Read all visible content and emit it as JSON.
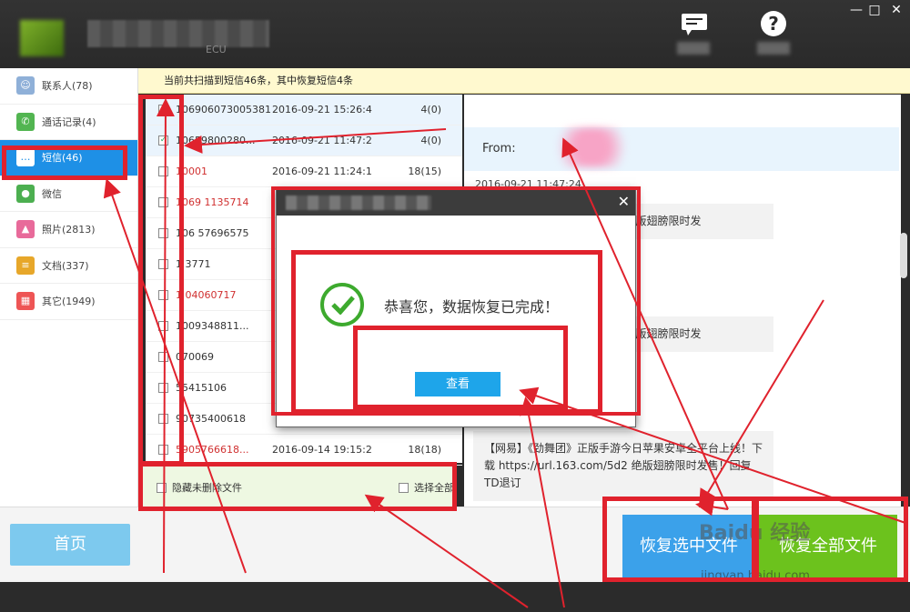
{
  "window": {
    "subtitle": "ECU",
    "close_label": "✕",
    "minimize_label": "—",
    "maximize_label": "□",
    "help_label": "?"
  },
  "notice": "当前共扫描到短信46条，其中恢复短信4条",
  "sidebar": {
    "items": [
      {
        "label": "联系人(78)",
        "icon": "contacts-icon",
        "color": "#8fb0d8"
      },
      {
        "label": "通话记录(4)",
        "icon": "phone-icon",
        "color": "#52b551"
      },
      {
        "label": "短信(46)",
        "icon": "sms-icon",
        "color": "#ffffff"
      },
      {
        "label": "微信",
        "icon": "wechat-icon",
        "color": "#4caf50"
      },
      {
        "label": "照片(2813)",
        "icon": "photo-icon",
        "color": "#e86a9a"
      },
      {
        "label": "文档(337)",
        "icon": "document-icon",
        "color": "#e7a72a"
      },
      {
        "label": "其它(1949)",
        "icon": "other-icon",
        "color": "#e55"
      }
    ]
  },
  "list": {
    "rows": [
      {
        "number": "106906073005381",
        "date": "2016-09-21 15:26:4",
        "count": "4(0)",
        "checked": true,
        "red": false
      },
      {
        "number": "10659800280...",
        "date": "2016-09-21 11:47:2",
        "count": "4(0)",
        "checked": true,
        "red": false
      },
      {
        "number": "10001",
        "date": "2016-09-21 11:24:1",
        "count": "18(15)",
        "checked": false,
        "red": true
      },
      {
        "number": "1069 1135714",
        "date": "",
        "count": "",
        "checked": false,
        "red": true
      },
      {
        "number": "106 57696575",
        "date": "",
        "count": "",
        "checked": false,
        "red": false
      },
      {
        "number": "1 3771",
        "date": "",
        "count": "",
        "checked": false,
        "red": false
      },
      {
        "number": "1 04060717",
        "date": "",
        "count": "",
        "checked": false,
        "red": true
      },
      {
        "number": "1009348811...",
        "date": "",
        "count": "",
        "checked": false,
        "red": false
      },
      {
        "number": "070069",
        "date": "",
        "count": "",
        "checked": false,
        "red": false
      },
      {
        "number": "55415106",
        "date": "",
        "count": "",
        "checked": false,
        "red": false
      },
      {
        "number": "90735400618",
        "date": "",
        "count": "",
        "checked": false,
        "red": false
      },
      {
        "number": "5905766618...",
        "date": "2016-09-14 19:15:2",
        "count": "18(18)",
        "checked": false,
        "red": true
      }
    ],
    "hide_undeleted_label": "隐藏未删除文件",
    "select_all_label": "选择全部"
  },
  "preview": {
    "from_label": "From:",
    "date": "2016-09-21 11:47:24",
    "bubble1": "今日苹果安卓全平台上 /5d2 绝版翅膀限时发",
    "bubble2": "今日苹果安卓全平台上 /5d2 绝版翅膀限时发",
    "bubble3": "【网易】《劲舞团》正版手游今日苹果安卓全平台上线！下载 https://url.163.com/5d2 绝版翅膀限时发售！回复TD退订"
  },
  "bottom": {
    "home_label": "首页",
    "recover_selected_label": "恢复选中文件",
    "recover_all_label": "恢复全部文件"
  },
  "dialog": {
    "message": "恭喜您，数据恢复已完成！",
    "view_label": "查看",
    "close_label": "✕"
  },
  "watermark": {
    "text": "Baidu 经验",
    "sub": "jingyan.baidu.com"
  },
  "colors": {
    "accent_red": "#e0222d",
    "blue": "#1ea5ea",
    "green": "#6cc21d"
  }
}
